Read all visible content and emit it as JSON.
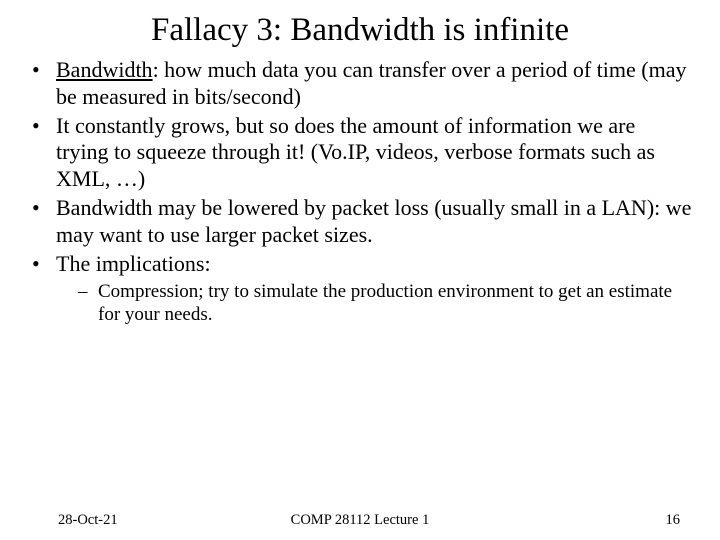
{
  "title": "Fallacy 3: Bandwidth is infinite",
  "bullets": {
    "b1_term": "Bandwidth",
    "b1_rest": ": how much data you can transfer over a period of time (may be measured in bits/second)",
    "b2": "It constantly grows, but so does the amount of information we are trying to squeeze through it! (Vo.IP, videos, verbose formats such as XML, …)",
    "b3": "Bandwidth may be lowered by packet loss (usually small in a LAN): we may want to use larger packet sizes.",
    "b4": "The implications:",
    "s1": "Compression; try to simulate the production environment to get an estimate for your needs."
  },
  "footer": {
    "date": "28-Oct-21",
    "course": "COMP 28112 Lecture 1",
    "page": "16"
  }
}
